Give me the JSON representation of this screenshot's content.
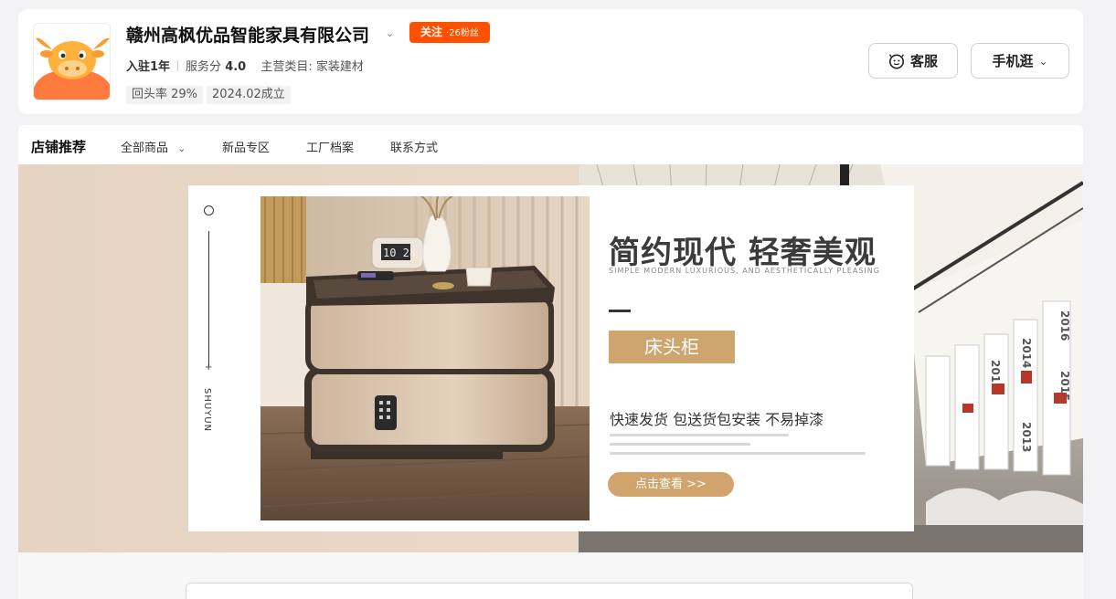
{
  "shop": {
    "name": "赣州高枫优品智能家具有限公司",
    "follow_label": "关注",
    "fans_label": "·26粉丝",
    "tenure": "入驻1年",
    "score_label": "服务分",
    "score_value": "4.0",
    "category": "主营类目: 家装建材",
    "tags": [
      "回头率 29%",
      "2024.02成立"
    ]
  },
  "actions": {
    "service_label": "客服",
    "mobile_label": "手机逛"
  },
  "nav": {
    "brand": "店铺推荐",
    "items": [
      "全部商品",
      "新品专区",
      "工厂档案",
      "联系方式"
    ]
  },
  "banner": {
    "headline": "简约现代 轻奢美观",
    "subline": "SIMPLE MODERN LUXURIOUS, AND AESTHETICALLY PLEASING",
    "category": "床头柜",
    "features": "快速发货 包送货包安装 不易掉漆",
    "cta": "点击查看 >>",
    "vertical_text": "SHUYUN",
    "clock_digits": "10 28",
    "wall_years": [
      "2016",
      "2015",
      "2014",
      "2013",
      "2012"
    ]
  },
  "colors": {
    "accent": "#ff5000",
    "gold": "#cfa56f"
  }
}
